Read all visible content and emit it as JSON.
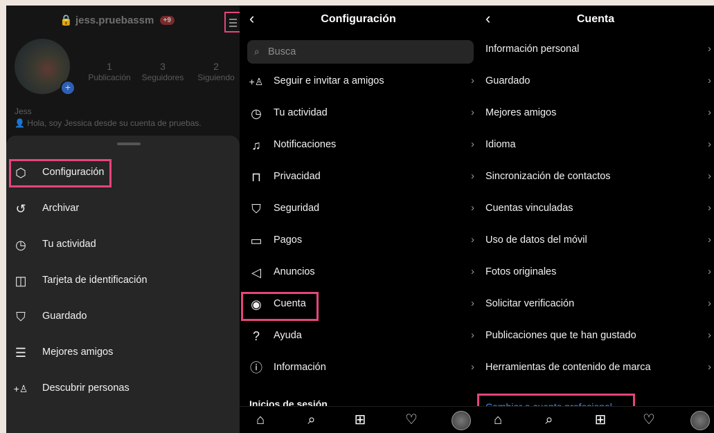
{
  "profile": {
    "username": "jess.pruebassm",
    "notif_count": "+9",
    "stats": [
      {
        "num": "1",
        "label": "Publicación"
      },
      {
        "num": "3",
        "label": "Seguidores"
      },
      {
        "num": "2",
        "label": "Siguiendo"
      }
    ],
    "name": "Jess",
    "bio": "Hola, soy Jessica desde su cuenta de pruebas."
  },
  "menu": {
    "items": [
      {
        "icon": "settings-icon",
        "glyph": "⬡",
        "label": "Configuración"
      },
      {
        "icon": "archive-icon",
        "glyph": "↺",
        "label": "Archivar"
      },
      {
        "icon": "activity-icon",
        "glyph": "◷",
        "label": "Tu actividad"
      },
      {
        "icon": "qr-icon",
        "glyph": "⌜⌟",
        "label": "Tarjeta de identificación"
      },
      {
        "icon": "bookmark-icon",
        "glyph": "🔖",
        "label": "Guardado"
      },
      {
        "icon": "close-friends-icon",
        "glyph": "☰",
        "label": "Mejores amigos"
      },
      {
        "icon": "discover-people-icon",
        "glyph": "+👤",
        "label": "Descubrir personas"
      }
    ]
  },
  "settings": {
    "title": "Configuración",
    "search_placeholder": "Busca",
    "items": [
      {
        "icon": "add-friend-icon",
        "glyph": "+👤",
        "label": "Seguir e invitar a amigos"
      },
      {
        "icon": "activity-icon",
        "glyph": "◷",
        "label": "Tu actividad"
      },
      {
        "icon": "bell-icon",
        "glyph": "🔔",
        "label": "Notificaciones"
      },
      {
        "icon": "lock-icon",
        "glyph": "🔒",
        "label": "Privacidad"
      },
      {
        "icon": "shield-icon",
        "glyph": "⛉",
        "label": "Seguridad"
      },
      {
        "icon": "card-icon",
        "glyph": "▭",
        "label": "Pagos"
      },
      {
        "icon": "megaphone-icon",
        "glyph": "📣",
        "label": "Anuncios"
      },
      {
        "icon": "account-icon",
        "glyph": "◉",
        "label": "Cuenta"
      },
      {
        "icon": "help-icon",
        "glyph": "?",
        "label": "Ayuda"
      },
      {
        "icon": "info-icon",
        "glyph": "i",
        "label": "Información"
      }
    ],
    "section_label": "Inicios de sesión"
  },
  "account": {
    "title": "Cuenta",
    "items": [
      "Información personal",
      "Guardado",
      "Mejores amigos",
      "Idioma",
      "Sincronización de contactos",
      "Cuentas vinculadas",
      "Uso de datos del móvil",
      "Fotos originales",
      "Solicitar verificación",
      "Publicaciones que te han gustado",
      "Herramientas de contenido de marca"
    ],
    "switch_link": "Cambiar a cuenta profesional"
  },
  "tabbar": [
    "home-icon",
    "search-icon",
    "add-post-icon",
    "heart-icon",
    "profile-avatar"
  ],
  "colors": {
    "highlight": "#e6457c",
    "link": "#3b8ff5",
    "background": "#000000",
    "sheet": "#262626"
  }
}
